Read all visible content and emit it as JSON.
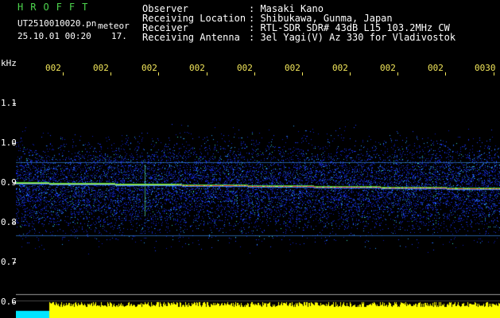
{
  "brand": "HROFFT",
  "file_name": "UT2510010020.pn",
  "tag": "meteor",
  "timestamp": "25.10.01 00:20",
  "counter": "17.",
  "header": [
    {
      "label": "Observer",
      "value": ": Masaki Kano"
    },
    {
      "label": "Receiving Location",
      "value": ": Shibukawa, Gunma, Japan"
    },
    {
      "label": "Receiver",
      "value": ": RTL-SDR SDR# 43dB L15 103.2MHz CW"
    },
    {
      "label": "Receiving Antenna",
      "value": ": 3el Yagi(V) Az 330 for Vladivostok"
    }
  ],
  "y_unit": "kHz",
  "y_ticks": [
    "1.1",
    "1.0",
    "0.9",
    "0.8",
    "0.7",
    "0.6"
  ],
  "time_ticks": [
    "002",
    "002",
    "002",
    "002",
    "002",
    "002",
    "002",
    "002",
    "002",
    "0030"
  ],
  "colors": {
    "title_green": "#4dd44d",
    "label_white": "#ffffff",
    "time_yellow": "#f2e65a",
    "carrier_red": "#ff2a20",
    "noise_blue": "#1f3cff",
    "level_bar_yellow": "#ffff00",
    "level_bar_cyan": "#00e5ff"
  }
}
